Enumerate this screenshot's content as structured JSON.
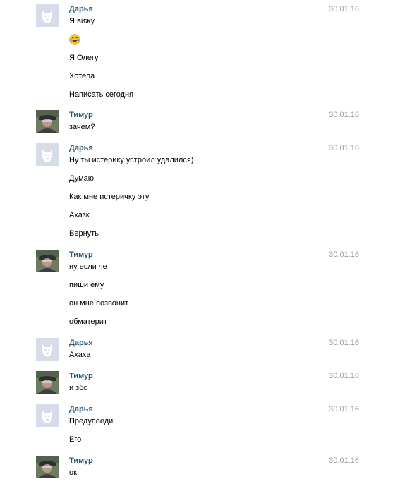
{
  "messages": [
    {
      "author": "Дарья",
      "date": "30.01.16",
      "avatar": "vk-default-dog-icon",
      "lines": [
        "Я вижу",
        "😂",
        "Я Олегу",
        "Хотела",
        "Написать сегодня"
      ]
    },
    {
      "author": "Тимур",
      "date": "30.01.16",
      "avatar": "user-photo",
      "lines": [
        "зачем?"
      ]
    },
    {
      "author": "Дарья",
      "date": "30.01.16",
      "avatar": "vk-default-dog-icon",
      "lines": [
        "Ну ты истерику устроил удалился)",
        "Думаю",
        "Как мне истеричку эту",
        "Ахазк",
        "Вернуть"
      ]
    },
    {
      "author": "Тимур",
      "date": "30.01.16",
      "avatar": "user-photo",
      "lines": [
        "ну если че",
        "пиши ему",
        "он мне позвонит",
        "обматерит"
      ]
    },
    {
      "author": "Дарья",
      "date": "30.01.16",
      "avatar": "vk-default-dog-icon",
      "lines": [
        "Ахаха"
      ]
    },
    {
      "author": "Тимур",
      "date": "30.01.16",
      "avatar": "user-photo",
      "lines": [
        "и збс"
      ]
    },
    {
      "author": "Дарья",
      "date": "30.01.16",
      "avatar": "vk-default-dog-icon",
      "lines": [
        "Предупоеди",
        "Его"
      ]
    },
    {
      "author": "Тимур",
      "date": "30.01.16",
      "avatar": "user-photo",
      "lines": [
        "ок"
      ]
    }
  ],
  "colors": {
    "author": "#2b587a",
    "date": "#999999",
    "text": "#000000",
    "avatar_bg": "#d6dde8"
  }
}
